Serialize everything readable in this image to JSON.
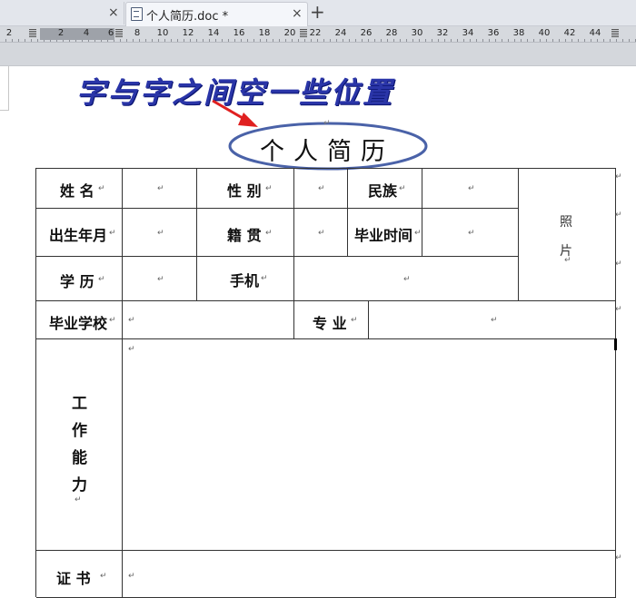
{
  "tabs": [
    {
      "title": "",
      "close": "×"
    },
    {
      "title": "个人简历.doc *",
      "close": "×",
      "active": true
    }
  ],
  "new_tab": "+",
  "ruler": {
    "numbers": [
      "2",
      "2",
      "4",
      "6",
      "8",
      "10",
      "12",
      "14",
      "16",
      "18",
      "20",
      "22",
      "24",
      "26",
      "28",
      "30",
      "32",
      "34",
      "36",
      "38",
      "40",
      "42",
      "44"
    ]
  },
  "annotation": "字与字之间空一些位置",
  "para_mark": "↵",
  "title": "个人简历",
  "table": {
    "name": "姓 名",
    "gender": "性 别",
    "ethnicity": "民族",
    "birth": "出生年月",
    "native_place": "籍 贯",
    "grad_time": "毕业时间",
    "education": "学 历",
    "phone": "手机",
    "school": "毕业学校",
    "major": "专 业",
    "work_ability": [
      "工",
      "作",
      "能",
      "力"
    ],
    "certificate": "证 书",
    "photo": [
      "照",
      "片"
    ]
  },
  "colors": {
    "annotation": "#2a35a8",
    "ellipse": "#4a62a8",
    "arrow": "#e02020"
  }
}
